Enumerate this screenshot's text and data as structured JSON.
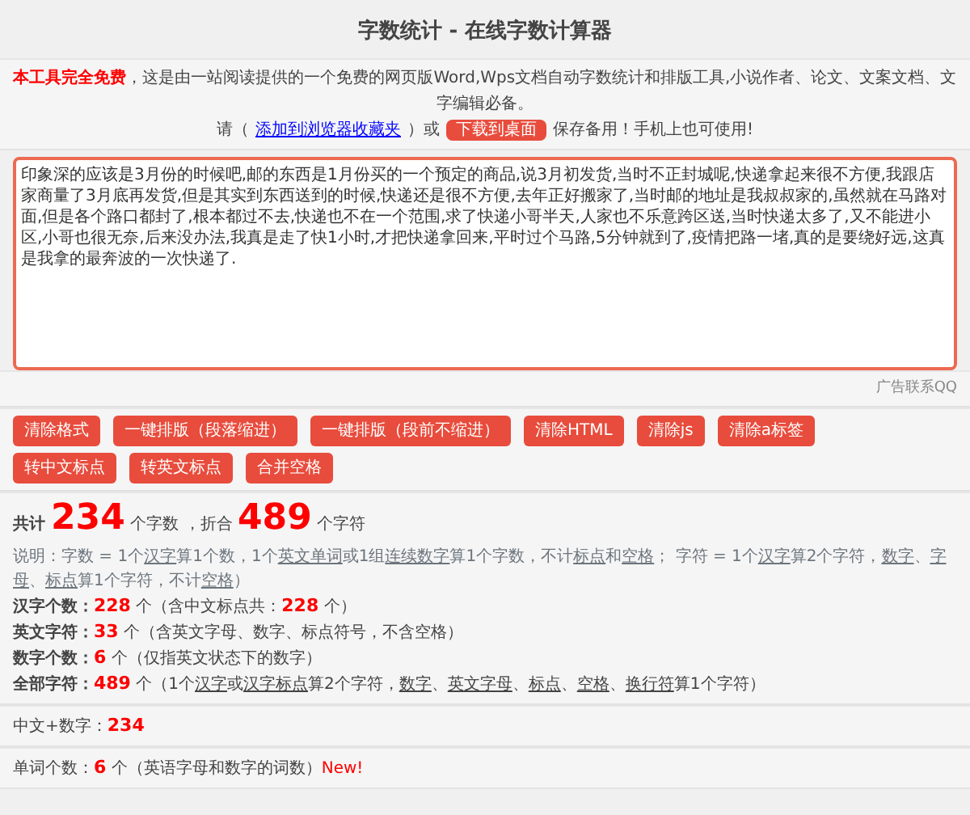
{
  "title": "字数统计 - 在线字数计算器",
  "intro": {
    "free_label": "本工具完全免费",
    "text": "，这是由一站阅读提供的一个免费的网页版Word,Wps文档自动字数统计和排版工具,小说作者、论文、文案文档、文字编辑必备。",
    "please": "请（",
    "bookmark_link": "添加到浏览器收藏夹",
    "or": "）或",
    "download_button": "下载到桌面",
    "save": "保存备用！手机上也可使用!"
  },
  "editor": {
    "value": "印象深的应该是3月份的时候吧,邮的东西是1月份买的一个预定的商品,说3月初发货,当时不正封城呢,快递拿起来很不方便,我跟店家商量了3月底再发货,但是其实到东西送到的时候,快递还是很不方便,去年正好搬家了,当时邮的地址是我叔叔家的,虽然就在马路对面,但是各个路口都封了,根本都过不去,快递也不在一个范围,求了快递小哥半天,人家也不乐意跨区送,当时快递太多了,又不能进小区,小哥也很无奈,后来没办法,我真是走了快1小时,才把快递拿回来,平时过个马路,5分钟就到了,疫情把路一堵,真的是要绕好远,这真是我拿的最奔波的一次快递了."
  },
  "ad_text": "广告联系QQ",
  "button_rows": [
    [
      "清除格式",
      "一键排版（段落缩进）",
      "一键排版（段前不缩进）",
      "清除HTML",
      "清除js",
      "清除a标签"
    ],
    [
      "转中文标点",
      "转英文标点",
      "合并空格"
    ]
  ],
  "stat_groups": [
    [
      {
        "kind": "total",
        "segments": [
          {
            "kind": "label",
            "text": "共计 "
          },
          {
            "kind": "big",
            "text": "234"
          },
          {
            "kind": "text",
            "text": " 个字数 ，折合 "
          },
          {
            "kind": "big",
            "text": "489"
          },
          {
            "kind": "text",
            "text": " 个字符"
          }
        ]
      },
      {
        "kind": "note",
        "segments": [
          {
            "kind": "text",
            "text": "说明：字数 = 1个"
          },
          {
            "kind": "term",
            "text": "汉字"
          },
          {
            "kind": "text",
            "text": "算1个数，1个"
          },
          {
            "kind": "term",
            "text": "英文单词"
          },
          {
            "kind": "text",
            "text": "或1组"
          },
          {
            "kind": "term",
            "text": "连续数字"
          },
          {
            "kind": "text",
            "text": "算1个字数，不计"
          },
          {
            "kind": "term",
            "text": "标点"
          },
          {
            "kind": "text",
            "text": "和"
          },
          {
            "kind": "term",
            "text": "空格"
          },
          {
            "kind": "text",
            "text": "； 字符 = 1个"
          },
          {
            "kind": "term",
            "text": "汉字"
          },
          {
            "kind": "text",
            "text": "算2个字符，"
          },
          {
            "kind": "term",
            "text": "数字"
          },
          {
            "kind": "text",
            "text": "、"
          },
          {
            "kind": "term",
            "text": "字母"
          },
          {
            "kind": "text",
            "text": "、"
          },
          {
            "kind": "term",
            "text": "标点"
          },
          {
            "kind": "text",
            "text": "算1个字符，不计"
          },
          {
            "kind": "term",
            "text": "空格"
          },
          {
            "kind": "text",
            "text": "）"
          }
        ]
      },
      {
        "kind": "stat",
        "segments": [
          {
            "kind": "label",
            "text": "汉字个数："
          },
          {
            "kind": "value",
            "text": "228"
          },
          {
            "kind": "text",
            "text": " 个（含中文标点共："
          },
          {
            "kind": "value",
            "text": "228"
          },
          {
            "kind": "text",
            "text": " 个）"
          }
        ]
      },
      {
        "kind": "stat",
        "segments": [
          {
            "kind": "label",
            "text": "英文字符："
          },
          {
            "kind": "value",
            "text": "33"
          },
          {
            "kind": "text",
            "text": " 个（含英文字母、数字、标点符号，不含空格）"
          }
        ]
      },
      {
        "kind": "stat",
        "segments": [
          {
            "kind": "label",
            "text": "数字个数："
          },
          {
            "kind": "value",
            "text": "6"
          },
          {
            "kind": "text",
            "text": " 个（仅指英文状态下的数字）"
          }
        ]
      },
      {
        "kind": "stat",
        "segments": [
          {
            "kind": "label",
            "text": "全部字符："
          },
          {
            "kind": "value",
            "text": "489"
          },
          {
            "kind": "text",
            "text": " 个（1个"
          },
          {
            "kind": "term",
            "text": "汉字"
          },
          {
            "kind": "text",
            "text": "或"
          },
          {
            "kind": "term",
            "text": "汉字标点"
          },
          {
            "kind": "text",
            "text": "算2个字符，"
          },
          {
            "kind": "term",
            "text": "数字"
          },
          {
            "kind": "text",
            "text": "、"
          },
          {
            "kind": "term",
            "text": "英文字母"
          },
          {
            "kind": "text",
            "text": "、"
          },
          {
            "kind": "term",
            "text": "标点"
          },
          {
            "kind": "text",
            "text": "、"
          },
          {
            "kind": "term",
            "text": "空格"
          },
          {
            "kind": "text",
            "text": "、"
          },
          {
            "kind": "term",
            "text": "换行符"
          },
          {
            "kind": "text",
            "text": "算1个字符）"
          }
        ]
      }
    ],
    [
      {
        "kind": "stat",
        "segments": [
          {
            "kind": "text",
            "text": "中文+数字："
          },
          {
            "kind": "value",
            "text": "234"
          }
        ]
      }
    ],
    [
      {
        "kind": "stat",
        "segments": [
          {
            "kind": "text",
            "text": "单词个数："
          },
          {
            "kind": "value",
            "text": "6"
          },
          {
            "kind": "text",
            "text": " 个（英语字母和数字的词数）"
          },
          {
            "kind": "new",
            "text": "New!"
          }
        ]
      }
    ]
  ]
}
